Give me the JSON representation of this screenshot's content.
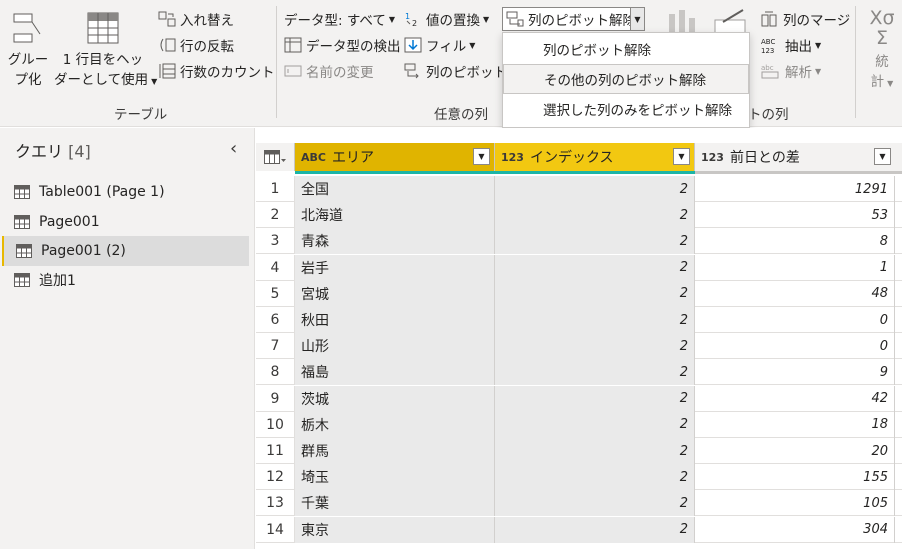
{
  "ribbon": {
    "table_group": {
      "group_by": "グループ\nブ化",
      "group_by_l1": "グルー",
      "group_by_l2": "プ化",
      "use_first_row_l1": "1 行目をヘッ",
      "use_first_row_l2": "ダーとして使用",
      "transpose": "入れ替え",
      "reverse_rows": "行の反転",
      "count_rows": "行数のカウント",
      "label": "テーブル"
    },
    "any_column_group": {
      "data_type": "データ型: すべて",
      "detect_type": "データ型の検出",
      "rename": "名前の変更",
      "replace_values": "値の置換",
      "fill": "フィル",
      "pivot_column": "列のピボット",
      "unpivot_columns": "列のピボット解除",
      "label": "任意の列"
    },
    "text_column_group": {
      "merge_columns": "列のマージ",
      "extract": "抽出",
      "parse": "解析",
      "label_suffix": "トの列"
    },
    "number_group": {
      "statistics_l1": "統",
      "statistics_l2": "計"
    }
  },
  "unpivot_menu": {
    "items": [
      {
        "label": "列のピボット解除",
        "highlighted": false
      },
      {
        "label": "その他の列のピボット解除",
        "highlighted": true
      },
      {
        "label": "選択した列のみをピボット解除",
        "highlighted": false
      }
    ]
  },
  "queries": {
    "title": "クエリ",
    "count": "[4]",
    "collapse_icon": "chevron-left-icon",
    "items": [
      {
        "label": "Table001 (Page 1)",
        "selected": false
      },
      {
        "label": "Page001",
        "selected": false
      },
      {
        "label": "Page001 (2)",
        "selected": true
      },
      {
        "label": "追加1",
        "selected": false
      }
    ]
  },
  "grid": {
    "columns": [
      {
        "type": "ABC",
        "name": "エリア",
        "header_color": "#e0b400"
      },
      {
        "type": "123",
        "name": "インデックス",
        "header_color": "#f2c811"
      },
      {
        "type": "123",
        "name": "前日との差",
        "header_color": "#f3f2f1"
      }
    ],
    "rows": [
      {
        "n": "1",
        "area": "全国",
        "index": "2",
        "diff": "1291"
      },
      {
        "n": "2",
        "area": "北海道",
        "index": "2",
        "diff": "53"
      },
      {
        "n": "3",
        "area": "青森",
        "index": "2",
        "diff": "8"
      },
      {
        "n": "4",
        "area": "岩手",
        "index": "2",
        "diff": "1"
      },
      {
        "n": "5",
        "area": "宮城",
        "index": "2",
        "diff": "48"
      },
      {
        "n": "6",
        "area": "秋田",
        "index": "2",
        "diff": "0"
      },
      {
        "n": "7",
        "area": "山形",
        "index": "2",
        "diff": "0"
      },
      {
        "n": "8",
        "area": "福島",
        "index": "2",
        "diff": "9"
      },
      {
        "n": "9",
        "area": "茨城",
        "index": "2",
        "diff": "42"
      },
      {
        "n": "10",
        "area": "栃木",
        "index": "2",
        "diff": "18"
      },
      {
        "n": "11",
        "area": "群馬",
        "index": "2",
        "diff": "20"
      },
      {
        "n": "12",
        "area": "埼玉",
        "index": "2",
        "diff": "155"
      },
      {
        "n": "13",
        "area": "千葉",
        "index": "2",
        "diff": "105"
      },
      {
        "n": "14",
        "area": "東京",
        "index": "2",
        "diff": "304"
      }
    ]
  },
  "colors": {
    "accent_teal": "#1cb5a6",
    "selected_yellow": "#f2c811"
  }
}
